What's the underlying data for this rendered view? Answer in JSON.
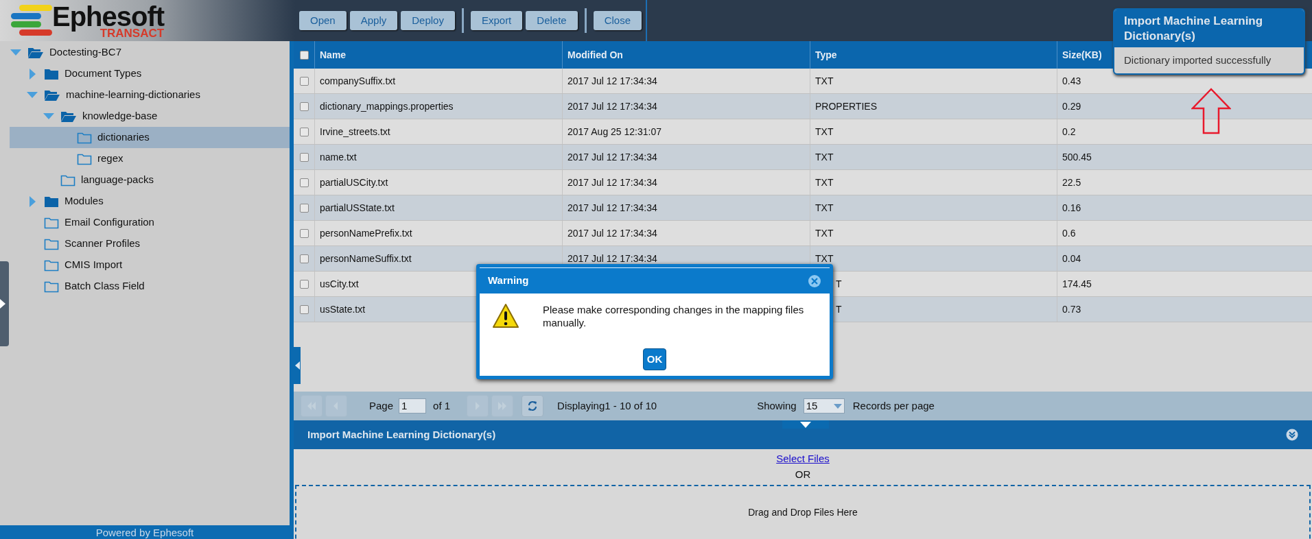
{
  "logo": {
    "name": "Ephesoft",
    "tagline": "TRANSACT"
  },
  "toolbar": {
    "groups": [
      [
        "Open",
        "Apply",
        "Deploy"
      ],
      [
        "Export",
        "Delete"
      ],
      [
        "Close"
      ]
    ]
  },
  "tree": [
    {
      "label": "Doctesting-BC7",
      "kind": "branch",
      "expanded": true,
      "selected": false,
      "children": [
        {
          "label": "Document Types",
          "kind": "branch",
          "expanded": false,
          "selected": false
        },
        {
          "label": "machine-learning-dictionaries",
          "kind": "branch",
          "expanded": true,
          "selected": false,
          "children": [
            {
              "label": "knowledge-base",
              "kind": "branch",
              "expanded": true,
              "selected": false,
              "children": [
                {
                  "label": "dictionaries",
                  "kind": "leaf",
                  "selected": true
                },
                {
                  "label": "regex",
                  "kind": "leaf",
                  "selected": false
                }
              ]
            },
            {
              "label": "language-packs",
              "kind": "leaf",
              "selected": false
            }
          ]
        },
        {
          "label": "Modules",
          "kind": "branch",
          "expanded": false,
          "selected": false
        },
        {
          "label": "Email Configuration",
          "kind": "leaf",
          "selected": false
        },
        {
          "label": "Scanner Profiles",
          "kind": "leaf",
          "selected": false
        },
        {
          "label": "CMIS Import",
          "kind": "leaf",
          "selected": false
        },
        {
          "label": "Batch Class Field",
          "kind": "leaf",
          "selected": false
        }
      ]
    }
  ],
  "sidebar_footer": "Powered by Ephesoft",
  "table": {
    "header_checked": false,
    "columns": [
      "Name",
      "Modified On",
      "Type",
      "Size(KB)"
    ],
    "rows": [
      {
        "checked": false,
        "cells": [
          "companySuffix.txt",
          "2017 Jul 12 17:34:34",
          "TXT",
          "0.43"
        ]
      },
      {
        "checked": false,
        "cells": [
          "dictionary_mappings.properties",
          "2017 Jul 12 17:34:34",
          "PROPERTIES",
          "0.29"
        ]
      },
      {
        "checked": false,
        "cells": [
          "Irvine_streets.txt",
          "2017 Aug 25 12:31:07",
          "TXT",
          "0.2"
        ]
      },
      {
        "checked": false,
        "cells": [
          "name.txt",
          "2017 Jul 12 17:34:34",
          "TXT",
          "500.45"
        ]
      },
      {
        "checked": false,
        "cells": [
          "partialUSCity.txt",
          "2017 Jul 12 17:34:34",
          "TXT",
          "22.5"
        ]
      },
      {
        "checked": false,
        "cells": [
          "partialUSState.txt",
          "2017 Jul 12 17:34:34",
          "TXT",
          "0.16"
        ]
      },
      {
        "checked": false,
        "cells": [
          "personNamePrefix.txt",
          "2017 Jul 12 17:34:34",
          "TXT",
          "0.6"
        ]
      },
      {
        "checked": false,
        "cells": [
          "personNameSuffix.txt",
          "2017 Jul 12 17:34:34",
          "TXT",
          "0.04"
        ]
      },
      {
        "checked": false,
        "covered": true,
        "cells": [
          "usCity.txt",
          "",
          "T",
          "174.45"
        ]
      },
      {
        "checked": false,
        "covered": true,
        "cells": [
          "usState.txt",
          "",
          "T",
          "0.73"
        ]
      }
    ]
  },
  "pagination": {
    "page_label": "Page",
    "page": "1",
    "of": "of 1",
    "displaying": "Displaying1 - 10 of 10",
    "showing": "Showing",
    "per_page": "15",
    "per_page_label": "Records per page"
  },
  "import_panel": {
    "title": "Import Machine Learning Dictionary(s)",
    "select_link": "Select Files",
    "or": "OR",
    "drop_hint": "Drag and Drop Files Here"
  },
  "notification": {
    "title": "Import Machine Learning Dictionary(s)",
    "message": "Dictionary imported successfully"
  },
  "dialog": {
    "title": "Warning",
    "message": "Please make corresponding changes in the mapping files manually.",
    "button": "OK"
  }
}
